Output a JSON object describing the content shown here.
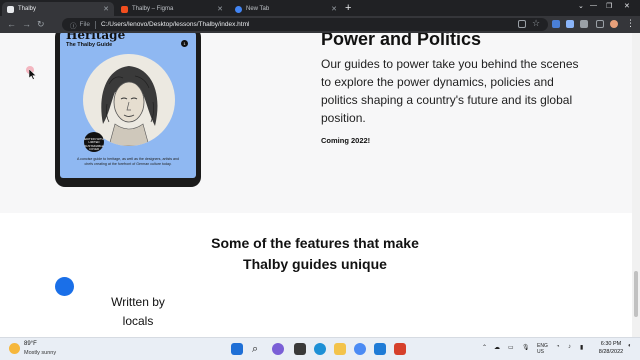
{
  "browser": {
    "tabs": [
      {
        "title": "Thalby",
        "active": true
      },
      {
        "title": "Thalby – Figma",
        "active": false
      },
      {
        "title": "New Tab",
        "active": false
      }
    ],
    "address": {
      "scheme_label": "File",
      "url": "C:/Users/lenovo/Desktop/lessons/Thalby/index.html"
    }
  },
  "book": {
    "brand": "Heritage",
    "subtitle": "The Thalby Guide",
    "badge_text": "EDITION WITH LIMITED SUSTAINABLE COVER",
    "description": "A concise guide to heritage, as well as the designers, artists and chefs creating at the forefront of German culture today."
  },
  "section": {
    "title": "Power and Politics",
    "body": "Our guides to power take you behind the scenes to explore the power dynamics, policies and politics shaping a country's future and its global position.",
    "status": "Coming 2022!"
  },
  "features": {
    "title": "Some of the features that make Thalby guides unique",
    "items": [
      {
        "label": "Written by locals"
      }
    ]
  },
  "taskbar": {
    "weather": {
      "temp": "89°F",
      "condition": "Mostly sunny"
    },
    "lang": {
      "line1": "ENG",
      "line2": "US"
    },
    "clock": {
      "time": "6:30 PM",
      "date": "8/28/2022"
    }
  },
  "colors": {
    "accent_blue": "#1a6fe8",
    "book_cover": "#8fb8f2",
    "chrome_dark": "#202124"
  }
}
